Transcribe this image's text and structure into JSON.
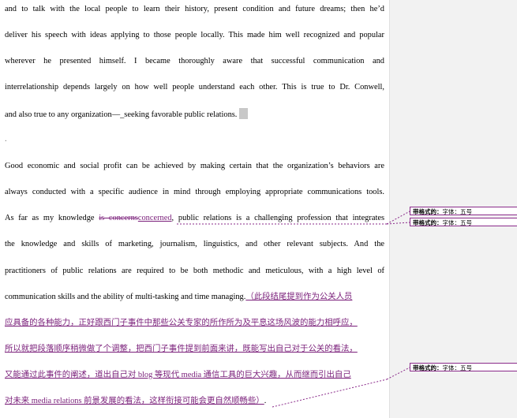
{
  "document": {
    "lines": [
      "and to talk with the local people to learn their history, present condition and future dreams; then he’d",
      "deliver his speech with ideas applying to those people locally. This made him well recognized and popular",
      "wherever he presented himself. I became thoroughly aware that successful communication and",
      "interrelationship depends largely on how well people understand each other. This is true to Dr. Conwell,",
      "and also true to any organization—_seeking favorable public relations.",
      "Good economic and social profit can be achieved by making certain that the organization’s behaviors are",
      "always conducted with a specific audience in mind through employing appropriate communications tools.",
      "the knowledge and skills of marketing, journalism, linguistics, and other relevant subjects. And the",
      "practitioners of public relations are required to be both methodic and meticulous, with a high level of"
    ],
    "line6_before": "As far as my knowledge ",
    "line6_deleted": "is concerns",
    "line6_inserted": "concerned",
    "line6_after": ", public relations is a challenging profession that integrates",
    "line10_text": "communication skills and the ability of multi-tasking and time managing.",
    "line10_comment": "（此段结尾提到作为公关人员",
    "comment_lines": [
      "应具备的各种能力，正好跟西门子事件中那些公关专家的所作所为及平息这场风波的能力相呼应，",
      "所以就把段落顺序稍微做了个调整，把西门子事件提到前面来讲，既能写出自己对于公关的看法，",
      "又能通过此事件的阐述，道出自己对 blog 等现代 media 通信工具的巨大兴趣，从而继而引出自己",
      "对未来 media relations 前景发展的看法，这样衔接可能会更自然顺畅些）"
    ],
    "paragraph_mark": "↓",
    "end_mark": "."
  },
  "revisions": [
    {
      "label": "带格式的：",
      "value": "字体：五号"
    },
    {
      "label": "带格式的：",
      "value": "字体：五号"
    },
    {
      "label": "带格式的：",
      "value": "字体：五号"
    }
  ],
  "colors": {
    "revision": "#7a1f7a",
    "margin_background": "#f2f2f2",
    "cursor_highlight": "#c8c8c8"
  }
}
